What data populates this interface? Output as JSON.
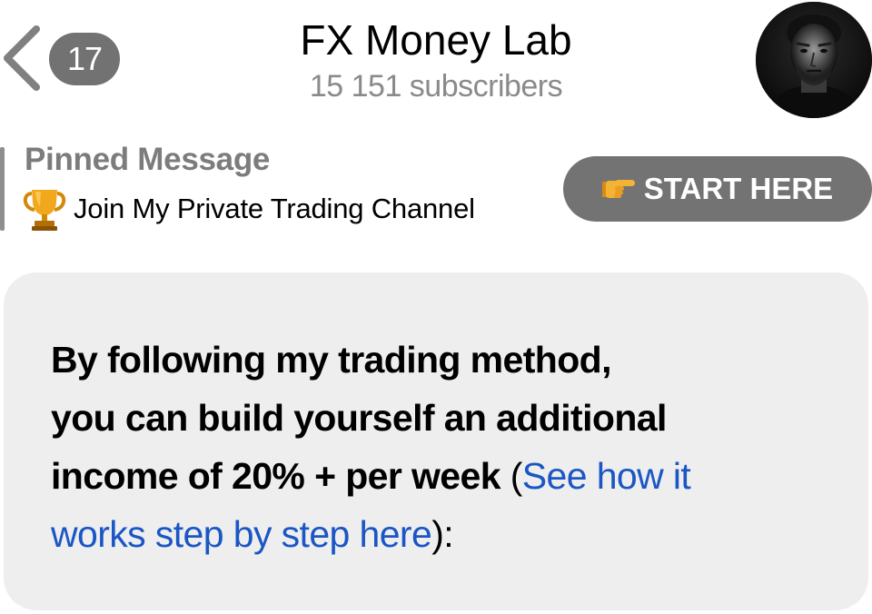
{
  "header": {
    "back_icon": "chevron-left-icon",
    "unread_count": "17",
    "title": "FX Money Lab",
    "subscribers": "15 151 subscribers",
    "avatar_icon": "channel-avatar"
  },
  "pinned": {
    "label": "Pinned Message",
    "icon": "trophy-icon",
    "text": "Join My Private Trading Channel",
    "bar_color": "#8e8e8e"
  },
  "start_button": {
    "icon": "pointing-hand-icon",
    "label": "START HERE",
    "bg_color": "#737373"
  },
  "message": {
    "bold_lines": [
      "By following my trading method,",
      "you can build yourself an additional",
      "income of 20% + per week"
    ],
    "open_paren": " (",
    "link_text_1": "See how it",
    "link_text_2": "works step by step here",
    "close": "):",
    "link_color": "#1a56c4",
    "bubble_color": "#eeeeee"
  }
}
